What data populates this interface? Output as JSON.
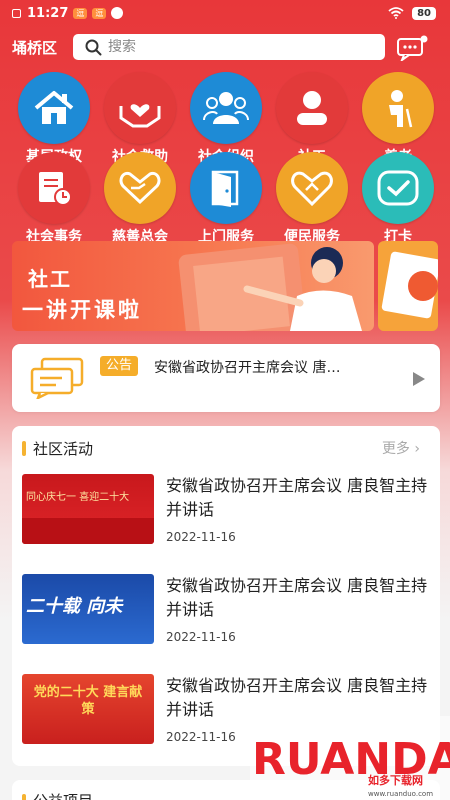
{
  "status_bar": {
    "time": "11:27",
    "notif_badges": [
      "逗",
      "逗"
    ],
    "battery": "80"
  },
  "header": {
    "location": "埇桥区",
    "search_placeholder": "搜索"
  },
  "grid": [
    {
      "label": "基层政权",
      "icon": "house-icon",
      "color": "#1e8bd6"
    },
    {
      "label": "社会救助",
      "icon": "hands-heart-icon",
      "color": "#e23a3a"
    },
    {
      "label": "社会组织",
      "icon": "people-group-icon",
      "color": "#1e8bd6"
    },
    {
      "label": "社工",
      "icon": "person-icon",
      "color": "#e23a3a"
    },
    {
      "label": "养老",
      "icon": "elder-icon",
      "color": "#f0a428"
    },
    {
      "label": "社会事务",
      "icon": "document-clock-icon",
      "color": "#e23a3a"
    },
    {
      "label": "慈善总会",
      "icon": "heart-hands-icon",
      "color": "#f0a428"
    },
    {
      "label": "上门服务",
      "icon": "door-icon",
      "color": "#1e8bd6"
    },
    {
      "label": "便民服务",
      "icon": "heart-hands-icon",
      "color": "#f0a428"
    },
    {
      "label": "打卡",
      "icon": "checkmark-icon",
      "color": "#2bbcb8"
    }
  ],
  "banner": {
    "line1": "社工",
    "line2": "一讲开课啦"
  },
  "notice": {
    "tag": "公告",
    "text": "安徽省政协召开主席会议 唐…"
  },
  "activities": {
    "title": "社区活动",
    "more": "更多",
    "items": [
      {
        "title": "安徽省政协召开主席会议 唐良智主持并讲话",
        "date": "2022-11-16",
        "thumb_text": "同心庆七一 喜迎二十大"
      },
      {
        "title": "安徽省政协召开主席会议 唐良智主持并讲话",
        "date": "2022-11-16",
        "thumb_text": "二十载 向未"
      },
      {
        "title": "安徽省政协召开主席会议 唐良智主持并讲话",
        "date": "2022-11-16",
        "thumb_text": "党的二十大 建言献策"
      }
    ]
  },
  "next_section": {
    "title": "公益项目"
  },
  "watermark": {
    "brand": "RUANDADO",
    "subtitle": "如多下载网",
    "url": "www.ruanduo.com"
  }
}
